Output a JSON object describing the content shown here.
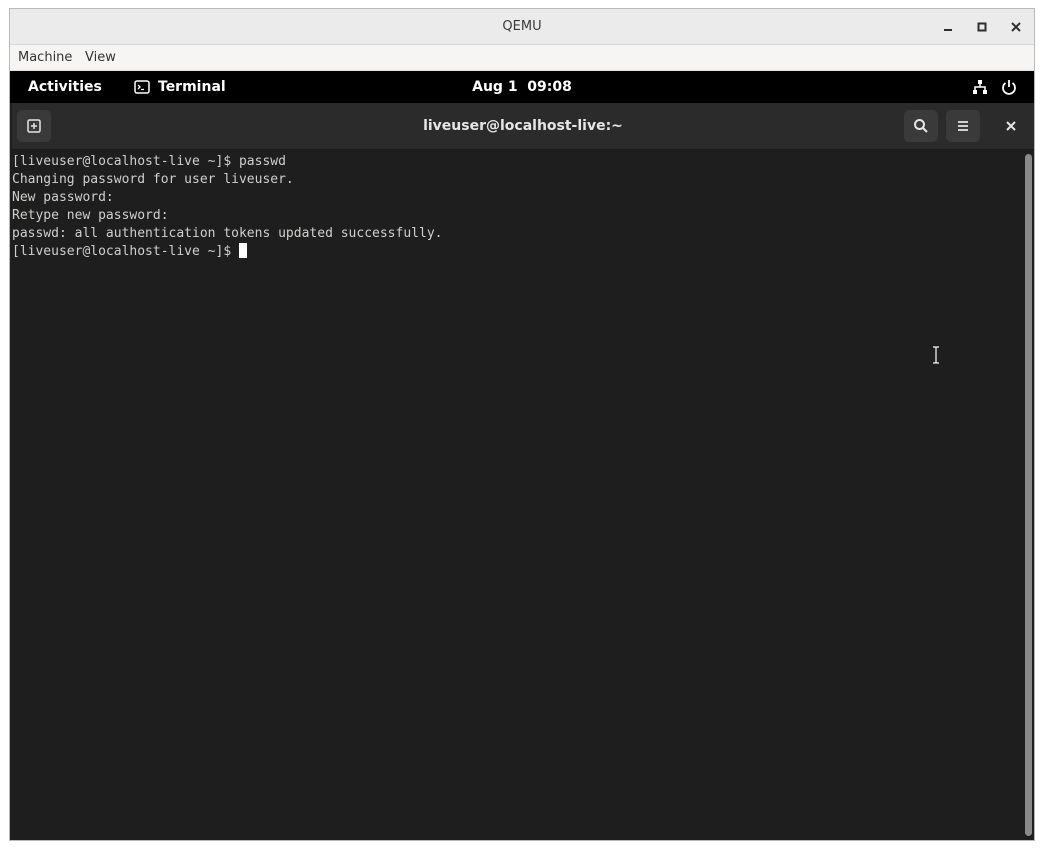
{
  "qemu": {
    "title": "QEMU",
    "menu": [
      "Machine",
      "View"
    ],
    "window_controls": [
      "minimize-icon",
      "maximize-icon",
      "close-icon"
    ]
  },
  "gnome": {
    "activities_label": "Activities",
    "app_name": "Terminal",
    "app_icon": "terminal-icon",
    "clock": "Aug 1  09:08",
    "status_icons": [
      "network-icon",
      "power-icon"
    ]
  },
  "terminal": {
    "title": "liveuser@localhost-live:~",
    "header_icons": [
      "new-tab-icon",
      "search-icon",
      "hamburger-menu-icon",
      "close-icon"
    ],
    "lines": [
      "[liveuser@localhost-live ~]$ passwd",
      "Changing password for user liveuser.",
      "New password:",
      "Retype new password:",
      "passwd: all authentication tokens updated successfully."
    ],
    "prompt": "[liveuser@localhost-live ~]$ ",
    "colors": {
      "background": "#1e1e1e",
      "foreground": "#d0cfcc",
      "header": "#2b2b2b",
      "topbar": "#000000"
    }
  }
}
